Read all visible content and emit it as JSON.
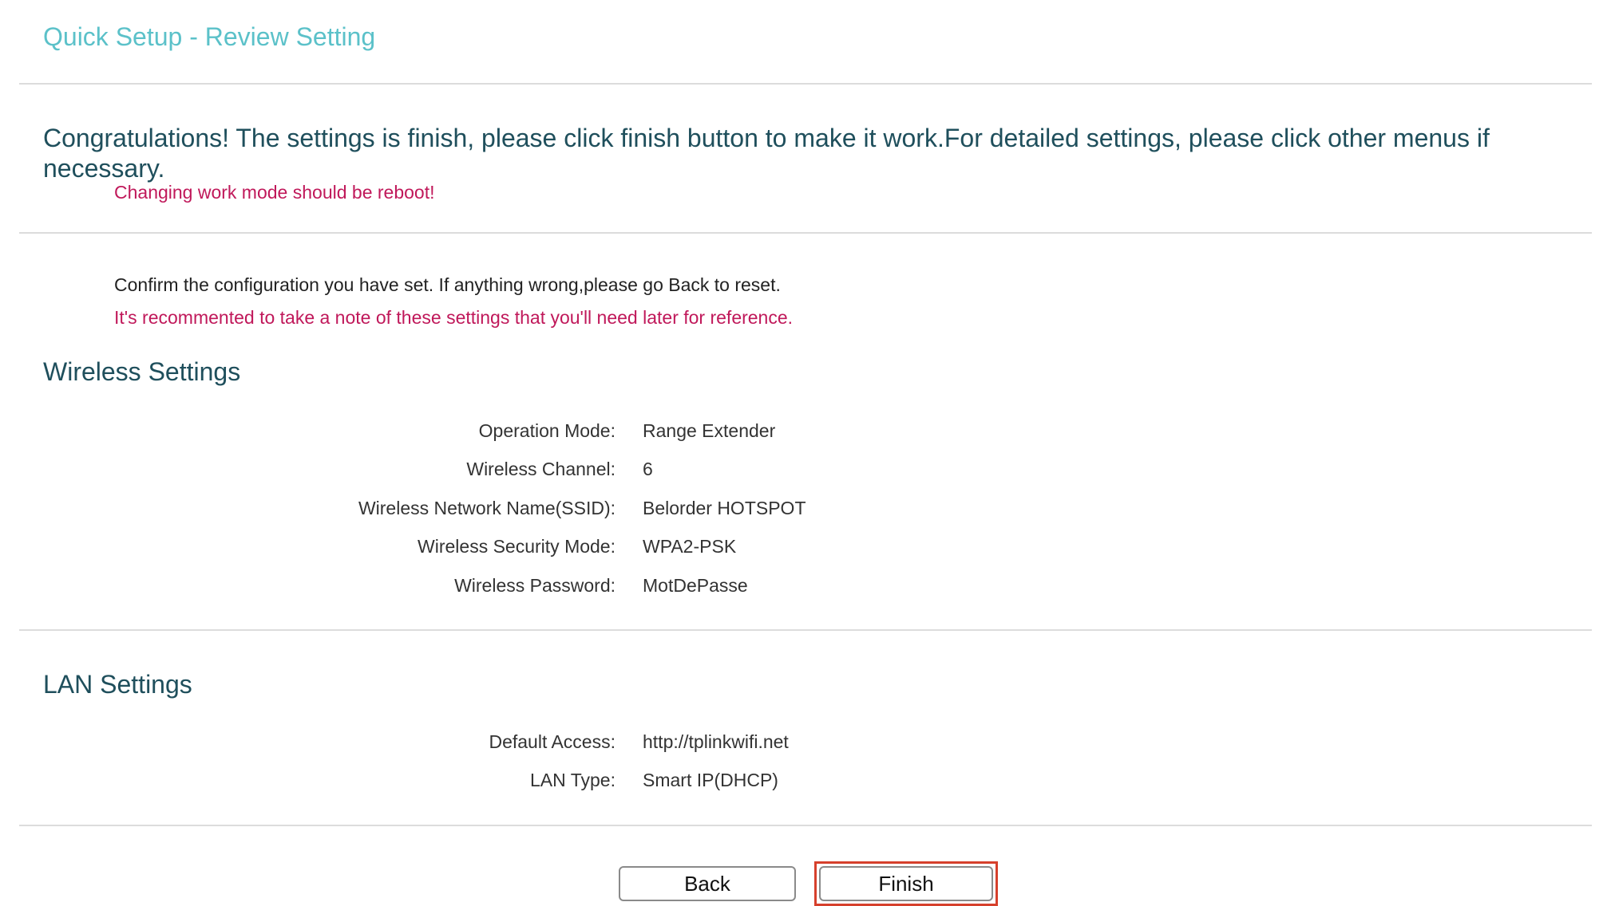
{
  "header": {
    "title": "Quick Setup - Review Setting"
  },
  "congrats": {
    "message": "Congratulations! The settings is finish, please click finish button to make it work.For detailed settings, please click other menus if necessary.",
    "reboot_note": "Changing work mode should be reboot!"
  },
  "confirm": {
    "text": "Confirm the configuration you have set. If anything wrong,please go Back to reset.",
    "recommendation": "It's recommented to take a note of these settings that you'll need later for reference."
  },
  "wireless": {
    "title": "Wireless Settings",
    "rows": [
      {
        "label": "Operation Mode:",
        "value": "Range Extender"
      },
      {
        "label": "Wireless Channel:",
        "value": "6"
      },
      {
        "label": "Wireless Network Name(SSID):",
        "value": "Belorder HOTSPOT"
      },
      {
        "label": "Wireless Security Mode:",
        "value": "WPA2-PSK"
      },
      {
        "label": "Wireless Password:",
        "value": "MotDePasse"
      }
    ]
  },
  "lan": {
    "title": "LAN Settings",
    "rows": [
      {
        "label": "Default Access:",
        "value": "http://tplinkwifi.net"
      },
      {
        "label": "LAN Type:",
        "value": "Smart IP(DHCP)"
      }
    ]
  },
  "buttons": {
    "back_label": "Back",
    "finish_label": "Finish"
  },
  "colors": {
    "title_teal": "#5bc1c9",
    "heading_dark_teal": "#1f4f5c",
    "note_crimson": "#c0185a",
    "highlight_red": "#d6402c"
  }
}
